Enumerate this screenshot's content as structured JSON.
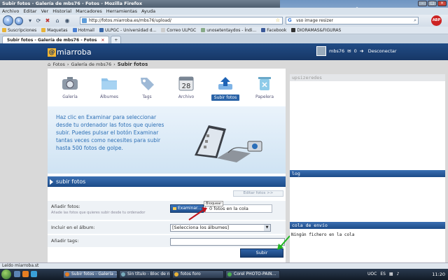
{
  "window": {
    "title": "Subir fotos - Galería de mbs76 - Fotos - Mozilla Firefox"
  },
  "menu": [
    "Archivo",
    "Editar",
    "Ver",
    "Historial",
    "Marcadores",
    "Herramientas",
    "Ayuda"
  ],
  "address": {
    "url": "http://fotos.miarroba.es/mbs76/upload/"
  },
  "search": {
    "value": "vso image resizer"
  },
  "bookmarks": [
    "Suscripciones",
    "Maquetas",
    "Hotmail",
    "ULPGC - Universidad d...",
    "Correo ULPGC",
    "unosetentaydos - Índi...",
    "Facebook",
    "DIORAMAS&FIGURAS"
  ],
  "tabs": [
    {
      "label": "Subir fotos - Galería de mbs76 - Fotos"
    }
  ],
  "site": {
    "logo_text": "miarroba",
    "logo_at": "@",
    "username": "mbs76",
    "messages": "0",
    "logout": "Desconectar"
  },
  "breadcrumb": {
    "root": "Fotos",
    "gallery": "Galería de mbs76",
    "current": "Subir fotos"
  },
  "icons": [
    {
      "label": "Galería"
    },
    {
      "label": "Álbumes"
    },
    {
      "label": "Tags"
    },
    {
      "label": "Archivo",
      "number": "28"
    },
    {
      "label": "Subir fotos"
    },
    {
      "label": "Papelera"
    }
  ],
  "banner": {
    "text": "Haz clic en Examinar para seleccionar desde tu ordenador las fotos que quieres subir. Puedes pulsar el botón Examinar tantas veces como necesites para subir hasta 500 fotos de golpe."
  },
  "section_title": "subir fotos",
  "edit_photos": "Editar fotos >>",
  "form": {
    "add_photos_label": "Añadir fotos:",
    "add_photos_hint": "Añade las fotos que quieres subir desde tu ordenador",
    "browse_button": "Examinar...",
    "queue_text": "0 fotos en la cola",
    "locked_badge": "Bloquear",
    "album_label": "Incluir en el álbum:",
    "album_select": "[Selecciona los álbumes]",
    "tags_label": "Añadir tags:",
    "submit": "Subir"
  },
  "sidebar": {
    "top_bar": "upsizeredes",
    "log_bar": "log",
    "queue_bar": "cola de envío",
    "queue_empty": "Ningún fichero en la cola"
  },
  "status_bar": "Leído miarroba.st",
  "taskbar": {
    "tasks": [
      "Subir fotos - Galería ...",
      "Sin título - Bloc de n...",
      "fotos foro",
      "Corel PHOTO-PAIN..."
    ],
    "lang": "UOC",
    "locale": "ES",
    "clock": "11:20"
  },
  "colors": {
    "brand_blue": "#1c4b88",
    "accent_link": "#2c6fb5",
    "arrow_red": "#c0141c",
    "arrow_green": "#21b521"
  }
}
